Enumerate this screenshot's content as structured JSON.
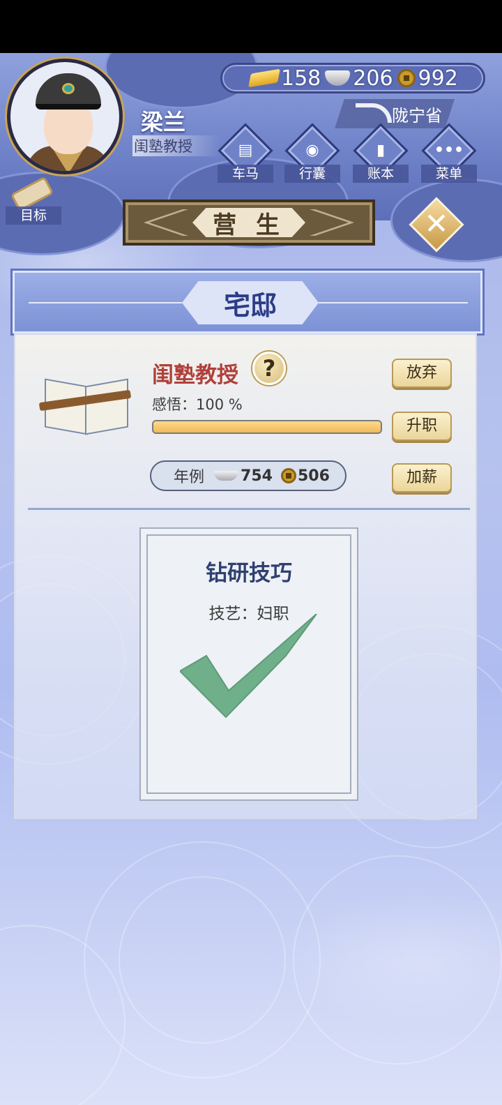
{
  "player": {
    "name": "梁兰",
    "title": "闺塾教授"
  },
  "currency": {
    "gold": "158",
    "silver": "206",
    "copper": "992"
  },
  "location": "陇宁省",
  "menu": [
    {
      "label": "车马",
      "icon": "carriage-icon"
    },
    {
      "label": "行囊",
      "icon": "bag-icon"
    },
    {
      "label": "账本",
      "icon": "ledger-icon"
    },
    {
      "label": "菜单",
      "icon": "more-icon"
    }
  ],
  "goal_label": "目标",
  "banner_title": "营 生",
  "panel_title": "宅邸",
  "job": {
    "title": "闺塾教授",
    "help": "?",
    "insight": "感悟：100 %",
    "progress": 1.0,
    "salary_label": "年例",
    "salary_silver": "754",
    "salary_copper": "506"
  },
  "buttons": {
    "abandon": "放弃",
    "promote": "升职",
    "raise": "加薪"
  },
  "task": {
    "title": "钻研技巧",
    "skill": "技艺：妇职",
    "done": true
  },
  "colors": {
    "accent": "#6f82c8",
    "job_title": "#b0403a",
    "check": "#6fb08a"
  }
}
